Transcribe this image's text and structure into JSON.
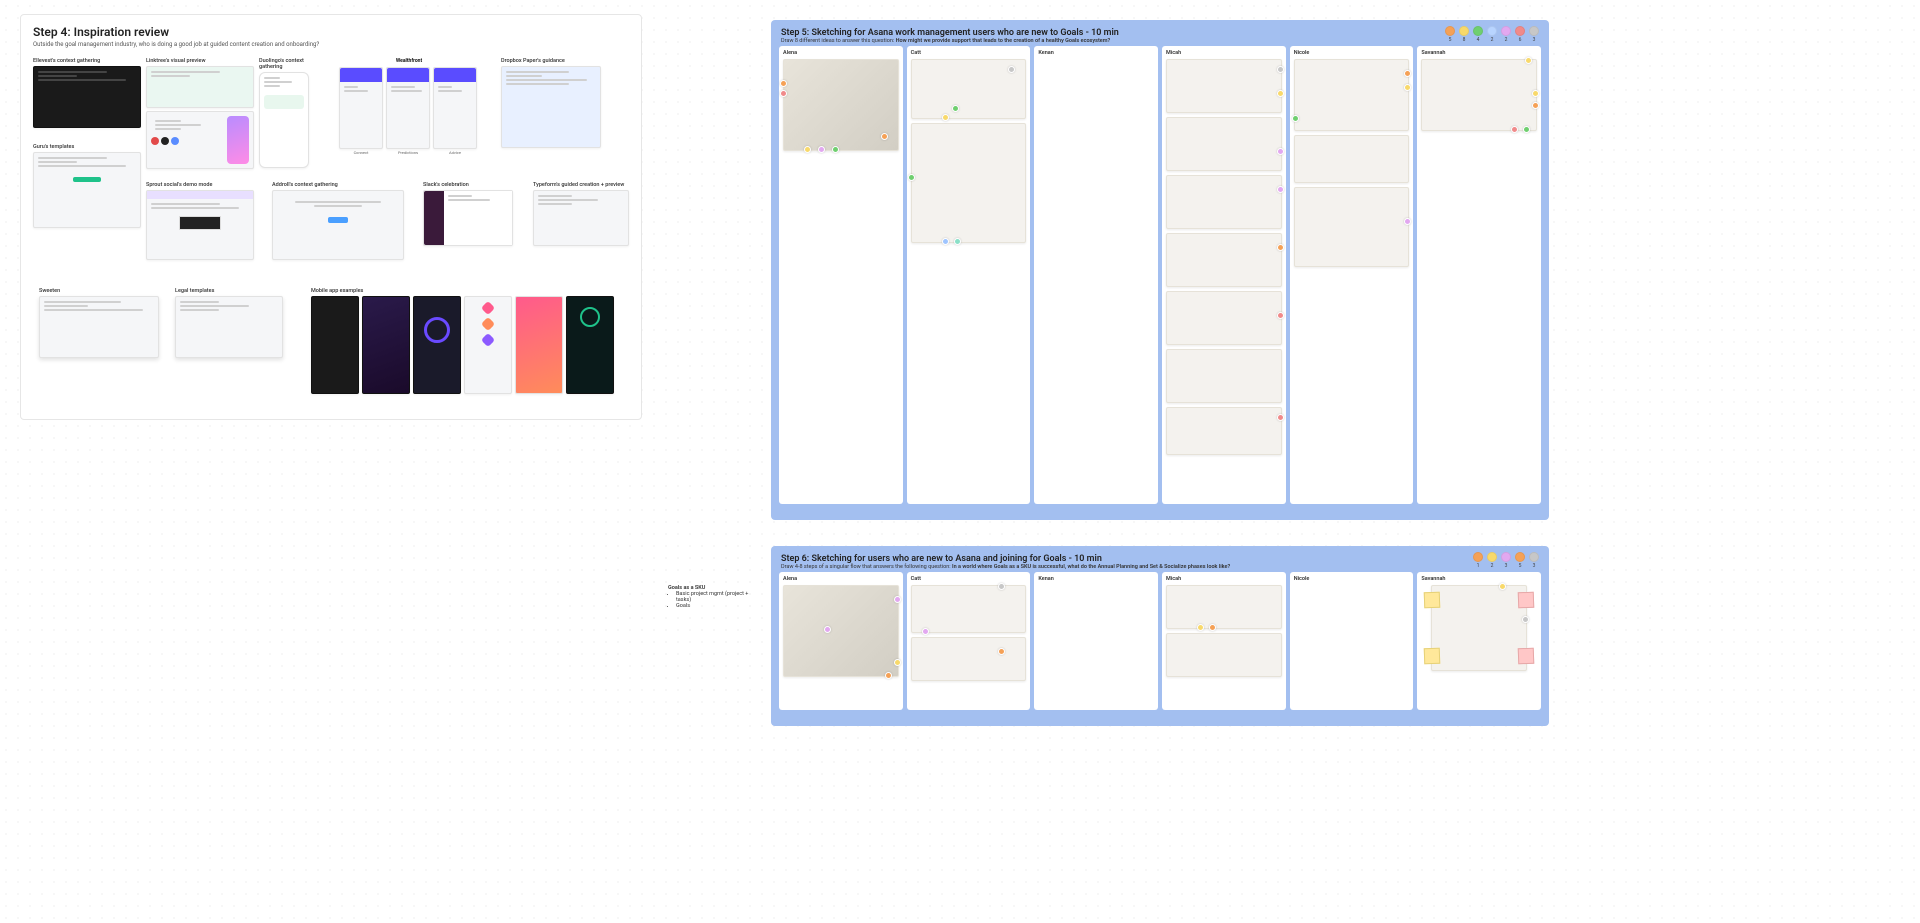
{
  "step4": {
    "title": "Step 4: Inspiration review",
    "subtitle": "Outside the goal management industry, who is doing a good job at guided content creation and onboarding?",
    "items": {
      "ellevest": "Ellevest's context gathering",
      "linktree": "Linktree's visual preview",
      "duolingo": "Duolingo's context gathering",
      "wealthfront_hdr": "Wealthfront",
      "wealthfront_c1": "Connect",
      "wealthfront_c2": "Predictions",
      "wealthfront_c3": "Advice",
      "dropbox": "Dropbox Paper's guidance",
      "guru": "Guru's templates",
      "sprout": "Sprout social's demo mode",
      "addroll": "Addroll's context gathering",
      "slack": "Slack's celebration",
      "typeform": "Typeform's guided creation + preview",
      "sweeten": "Sweeten",
      "legal": "Legal templates",
      "mobile": "Mobile app examples"
    }
  },
  "step5": {
    "title": "Step 5: Sketching for Asana work management users who are new to Goals - 10 min",
    "sub_a": "Draw 8 different ideas to answer this question: ",
    "sub_b": "How might we provide support that leads to the creation of a healthy Goals ecosystem?",
    "pills": [
      {
        "c": "o",
        "n": "5"
      },
      {
        "c": "y",
        "n": "8"
      },
      {
        "c": "g",
        "n": "4"
      },
      {
        "c": "b",
        "n": "2"
      },
      {
        "c": "p",
        "n": "2"
      },
      {
        "c": "r",
        "n": "6"
      },
      {
        "c": "gr",
        "n": "3"
      }
    ],
    "names": [
      "Alena",
      "Catt",
      "Kenan",
      "Micah",
      "Nicole",
      "Savannah"
    ]
  },
  "step6": {
    "title": "Step 6: Sketching for users who are new to Asana and joining for Goals - 10 min",
    "sub_a": "Draw 4-8 steps of a singular flow that answers the following question: ",
    "sub_b": "In a world where Goals as a SKU is successful, what do the Annual Planning and Set & Socialize phases look like?",
    "pills": [
      {
        "c": "o",
        "n": "1"
      },
      {
        "c": "y",
        "n": "2"
      },
      {
        "c": "p",
        "n": "3"
      },
      {
        "c": "o",
        "n": "5"
      },
      {
        "c": "gr",
        "n": "3"
      }
    ],
    "names": [
      "Alena",
      "Catt",
      "Kenan",
      "Micah",
      "Nicole",
      "Savannah"
    ]
  },
  "sidenote": {
    "title": "Goals as a SKU",
    "li1": "Basic project mgmt (project + tasks)",
    "li2": "Goals"
  }
}
